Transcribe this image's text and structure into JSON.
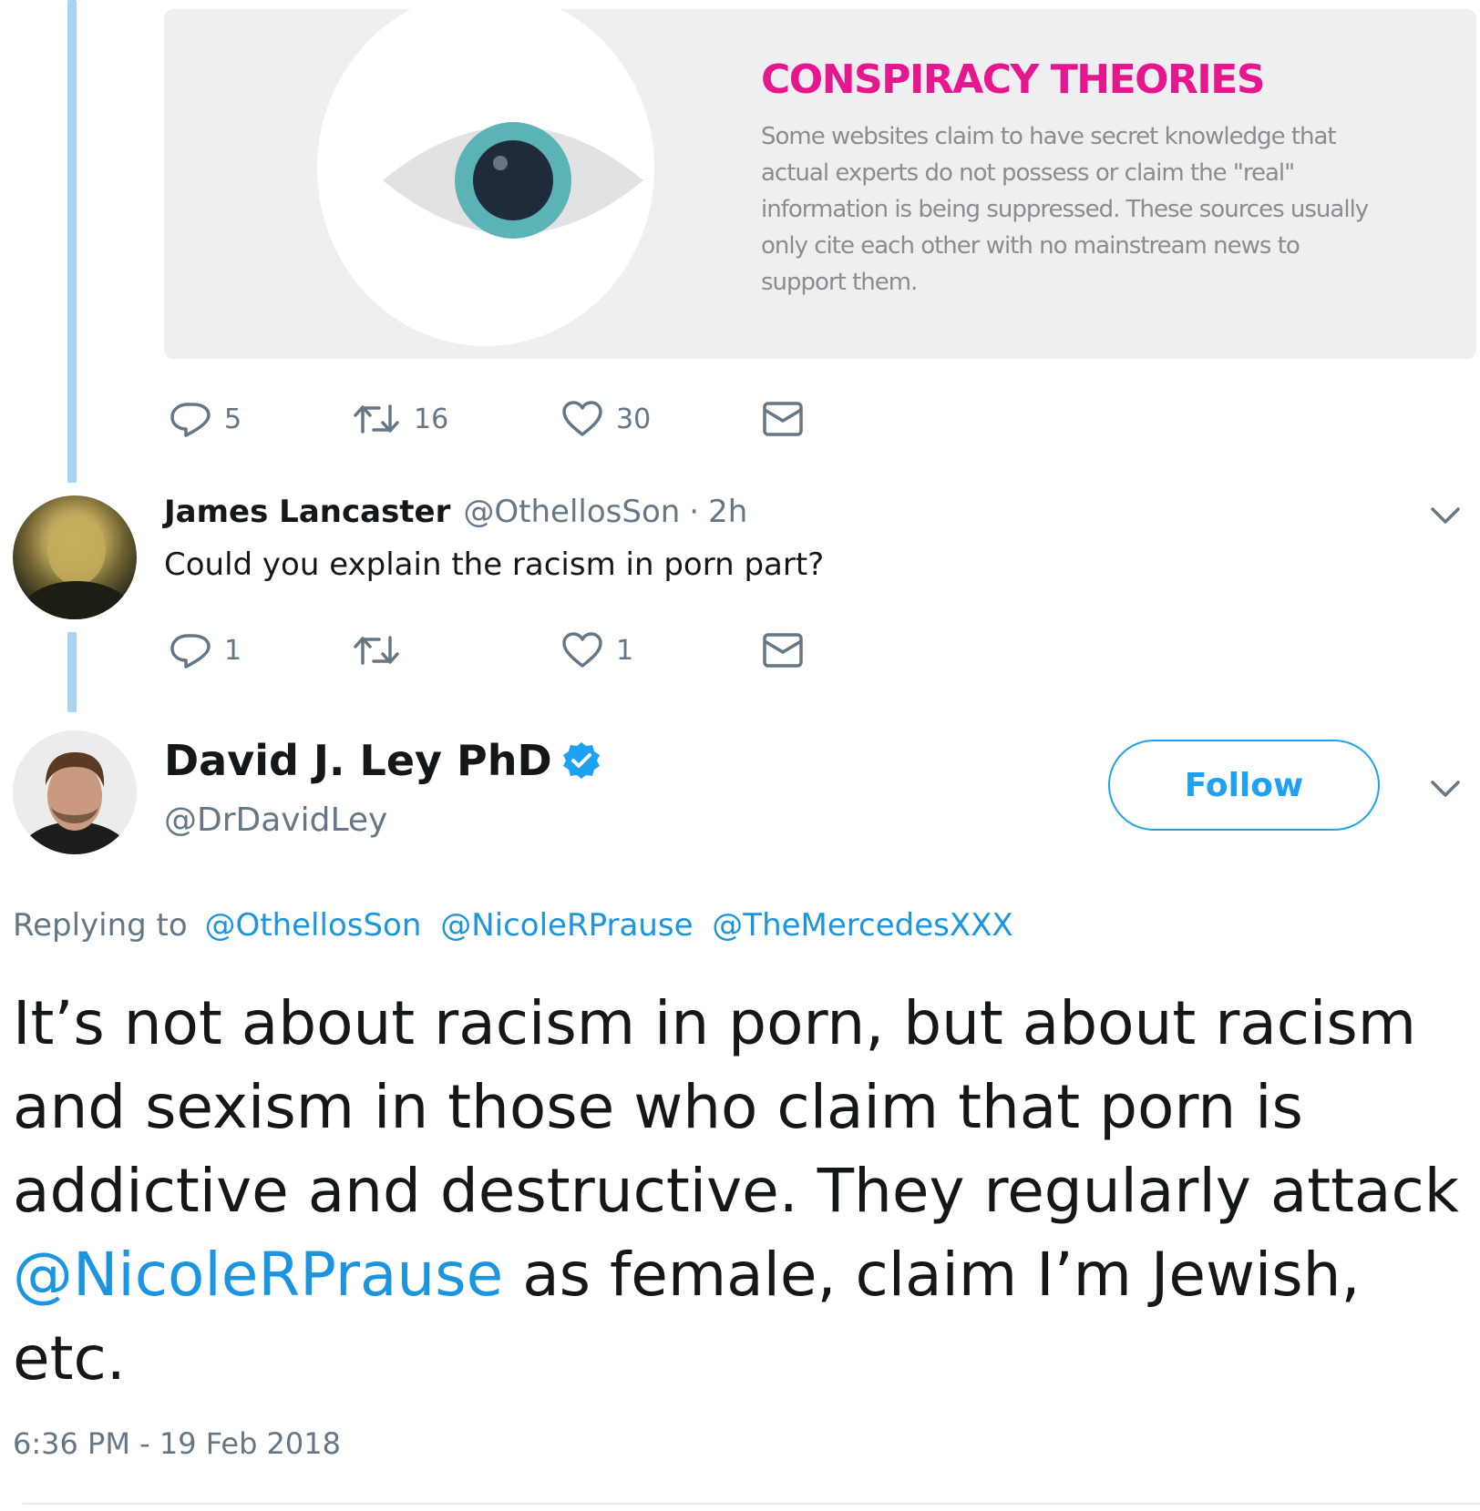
{
  "card": {
    "title": "CONSPIRACY THEORIES",
    "text": "Some websites claim to have secret knowledge that actual experts do not possess or claim the \"real\" information is being suppressed. These sources usually only cite each other with no mainstream news to support them."
  },
  "tweet1_actions": {
    "replies": "5",
    "retweets": "16",
    "likes": "30"
  },
  "reply": {
    "name": "James Lancaster",
    "handle": "@OthellosSon",
    "separator": "·",
    "time": "2h",
    "text": "Could you explain the racism in porn part?",
    "actions": {
      "replies": "1",
      "retweets": "",
      "likes": "1"
    }
  },
  "main_tweet": {
    "name": "David J. Ley PhD",
    "handle": "@DrDavidLey",
    "follow_label": "Follow",
    "replying_prefix": "Replying to",
    "replying_mentions": [
      "@OthellosSon",
      "@NicoleRPrause",
      "@TheMercedesXXX"
    ],
    "text_part1": "It’s not about racism in porn, but about racism and sexism in those who claim that porn is addictive and destructive. They regularly attack ",
    "text_mention": "@NicoleRPrause",
    "text_part2": " as female, claim I’m Jewish, etc.",
    "timestamp": "6:36 PM - 19 Feb 2018"
  },
  "colors": {
    "accent": "#1da1f2",
    "link": "#1b95e0",
    "muted": "#657786",
    "thread_line": "#a8d4f2",
    "card_title": "#e5168e"
  },
  "icons": [
    "reply-icon",
    "retweet-icon",
    "like-icon",
    "direct-message-icon",
    "chevron-down-icon",
    "verified-badge-icon"
  ]
}
